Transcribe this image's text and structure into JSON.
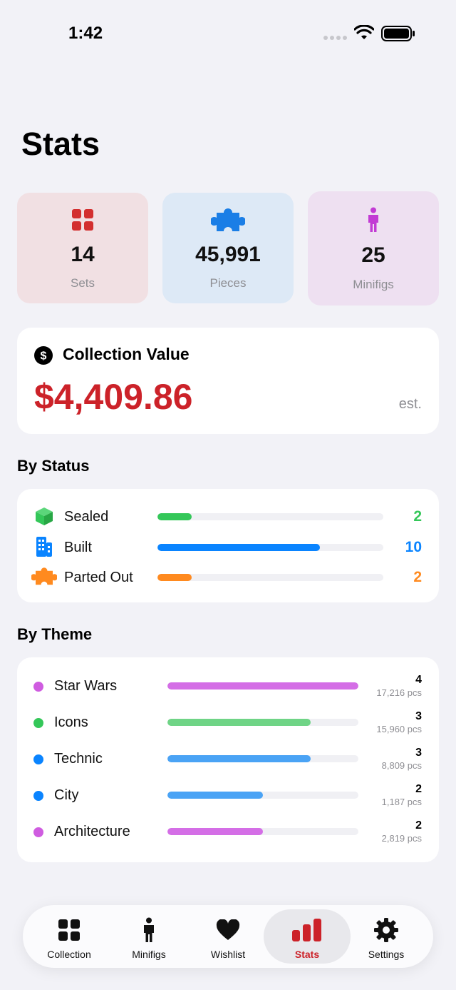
{
  "status_bar": {
    "time": "1:42"
  },
  "page_title": "Stats",
  "summary": [
    {
      "value": "14",
      "label": "Sets",
      "icon": "grid-icon",
      "color": "#d32f2f"
    },
    {
      "value": "45,991",
      "label": "Pieces",
      "icon": "puzzle-icon",
      "color": "#1a7ee6"
    },
    {
      "value": "25",
      "label": "Minifigs",
      "icon": "person-icon",
      "color": "#c23bd4"
    }
  ],
  "collection_value": {
    "title": "Collection Value",
    "amount": "$4,409.86",
    "suffix": "est.",
    "icon": "dollar-circle-icon",
    "accent": "#cc2229"
  },
  "by_status": {
    "title": "By Status",
    "items": [
      {
        "label": "Sealed",
        "count": "2",
        "fraction": 0.15,
        "color": "#34c759",
        "icon": "cube-icon"
      },
      {
        "label": "Built",
        "count": "10",
        "fraction": 0.72,
        "color": "#0a84ff",
        "icon": "building-icon"
      },
      {
        "label": "Parted Out",
        "count": "2",
        "fraction": 0.15,
        "color": "#ff8a1f",
        "icon": "puzzle-icon"
      }
    ]
  },
  "by_theme": {
    "title": "By Theme",
    "items": [
      {
        "label": "Star Wars",
        "count": "4",
        "pieces": "17,216 pcs",
        "fraction": 1.0,
        "color": "#cf5ce0"
      },
      {
        "label": "Icons",
        "count": "3",
        "pieces": "15,960 pcs",
        "fraction": 0.75,
        "color": "#34c759"
      },
      {
        "label": "Technic",
        "count": "3",
        "pieces": "8,809 pcs",
        "fraction": 0.75,
        "color": "#0a84ff"
      },
      {
        "label": "City",
        "count": "2",
        "pieces": "1,187 pcs",
        "fraction": 0.5,
        "color": "#0a84ff"
      },
      {
        "label": "Architecture",
        "count": "2",
        "pieces": "2,819 pcs",
        "fraction": 0.5,
        "color": "#cf5ce0"
      }
    ]
  },
  "tabs": [
    {
      "label": "Collection",
      "icon": "grid-icon",
      "active": false
    },
    {
      "label": "Minifigs",
      "icon": "person-icon",
      "active": false
    },
    {
      "label": "Wishlist",
      "icon": "heart-icon",
      "active": false
    },
    {
      "label": "Stats",
      "icon": "bar-chart-icon",
      "active": true
    },
    {
      "label": "Settings",
      "icon": "gear-icon",
      "active": false
    }
  ]
}
